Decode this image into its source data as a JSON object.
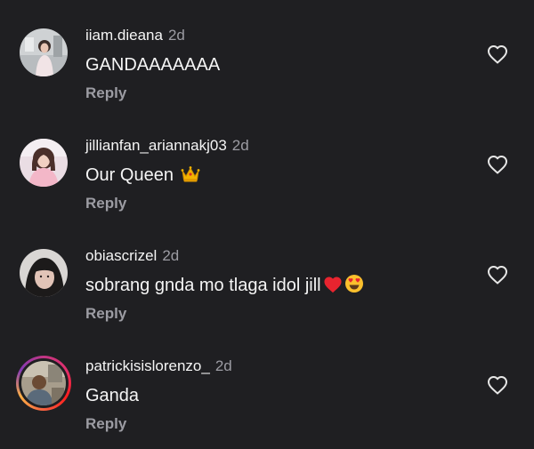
{
  "comments": [
    {
      "username": "iiam.dieana",
      "time": "2d",
      "text": "GANDAAAAAAA",
      "reply_label": "Reply",
      "like_icon": "heart-outline-icon",
      "avatar_ring": false
    },
    {
      "username": "jillianfan_ariannakj03",
      "time": "2d",
      "text": "Our Queen",
      "emojis": [
        "crown-emoji"
      ],
      "reply_label": "Reply",
      "like_icon": "heart-outline-icon",
      "avatar_ring": false
    },
    {
      "username": "obiascrizel",
      "time": "2d",
      "text": "sobrang gnda mo tlaga idol jill",
      "emojis": [
        "red-heart-emoji",
        "heart-eyes-emoji"
      ],
      "reply_label": "Reply",
      "like_icon": "heart-outline-icon",
      "avatar_ring": false
    },
    {
      "username": "patrickisislorenzo_",
      "time": "2d",
      "text": "Ganda",
      "reply_label": "Reply",
      "like_icon": "heart-outline-icon",
      "avatar_ring": true
    }
  ],
  "colors": {
    "background": "#1f1f22",
    "primary_text": "#f5f5f5",
    "secondary_text": "#9c9ca3",
    "heart_red": "#e8242f",
    "story_ring": "#e1306c"
  }
}
